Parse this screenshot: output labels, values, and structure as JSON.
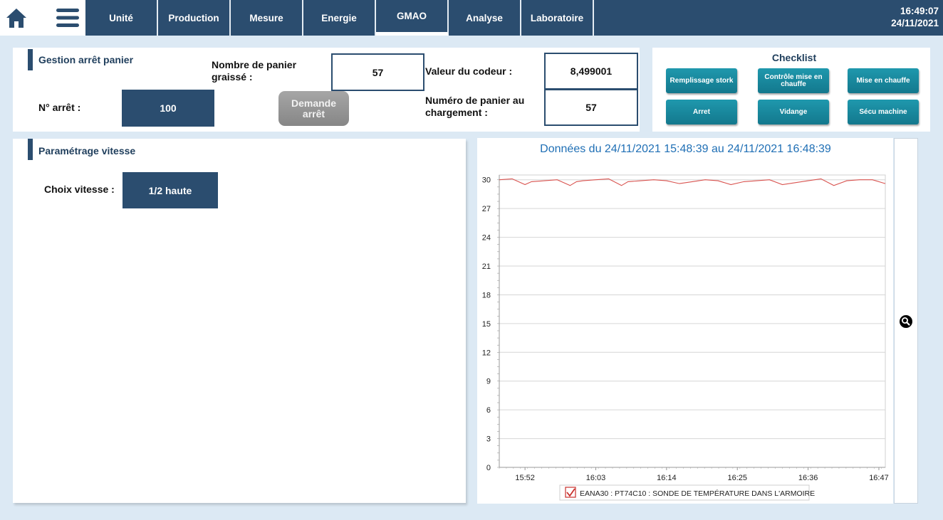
{
  "nav": {
    "tabs": [
      "Unité",
      "Production",
      "Mesure",
      "Energie",
      "GMAO",
      "Analyse",
      "Laboratoire"
    ],
    "active_tab": "GMAO",
    "time": "16:49:07",
    "date": "24/11/2021"
  },
  "gestion": {
    "title": "Gestion arrêt panier",
    "arret_label": "N° arrêt :",
    "arret_value": "100",
    "graisse_label": "Nombre de panier graissé :",
    "graisse_value": "57",
    "demande_button": "Demande arrêt",
    "codeur_label": "Valeur du codeur :",
    "codeur_value": "8,499001",
    "chargement_label": "Numéro de panier au chargement :",
    "chargement_value": "57"
  },
  "checklist": {
    "title": "Checklist",
    "buttons": [
      "Remplissage stork",
      "Contrôle mise en chauffe",
      "Mise en chauffe",
      "Arret",
      "Vidange",
      "Sécu machine"
    ]
  },
  "vitesse": {
    "title": "Paramétrage vitesse",
    "choix_label": "Choix vitesse :",
    "choix_value": "1/2 haute"
  },
  "icons": {
    "home": "home-icon",
    "menu": "hamburger-menu-icon",
    "zoom": "magnifier-zoom-icon",
    "legend_check": "checkbox-checked-icon"
  },
  "colors": {
    "nav": "#2b4d6f",
    "teal": "#1a8ca0",
    "series": "#d9534f",
    "title": "#1f6fb5"
  },
  "chart_data": {
    "type": "line",
    "title": "Données du 24/11/2021 15:48:39 au 24/11/2021 16:48:39",
    "xlabel": "",
    "ylabel": "",
    "x_ticks": [
      "15:52",
      "16:03",
      "16:14",
      "16:25",
      "16:36",
      "16:47"
    ],
    "y_ticks": [
      0,
      3,
      6,
      9,
      12,
      15,
      18,
      21,
      24,
      27,
      30
    ],
    "ylim": [
      0,
      30.5
    ],
    "xlim_minutes": [
      "15:48",
      "16:48"
    ],
    "grid": true,
    "legend": "bottom",
    "series": [
      {
        "name": "EANA30 : PT74C10 : SONDE DE TEMPÉRATURE DANS L'ARMOIRE",
        "color": "#d9534f",
        "x": [
          "15:48",
          "15:50",
          "15:52",
          "15:53",
          "15:55",
          "15:57",
          "15:59",
          "16:00",
          "16:01",
          "16:03",
          "16:05",
          "16:07",
          "16:08",
          "16:10",
          "16:12",
          "16:14",
          "16:16",
          "16:18",
          "16:20",
          "16:22",
          "16:24",
          "16:26",
          "16:28",
          "16:30",
          "16:32",
          "16:34",
          "16:36",
          "16:38",
          "16:40",
          "16:42",
          "16:44",
          "16:46",
          "16:48"
        ],
        "y": [
          30.0,
          30.1,
          29.5,
          29.8,
          29.9,
          30.0,
          29.4,
          29.8,
          29.9,
          30.0,
          30.1,
          29.4,
          29.8,
          29.9,
          30.0,
          29.9,
          29.6,
          29.8,
          30.0,
          29.9,
          29.5,
          29.8,
          29.9,
          30.0,
          29.5,
          29.7,
          29.9,
          30.1,
          29.4,
          29.9,
          30.0,
          30.0,
          29.6
        ]
      }
    ]
  }
}
